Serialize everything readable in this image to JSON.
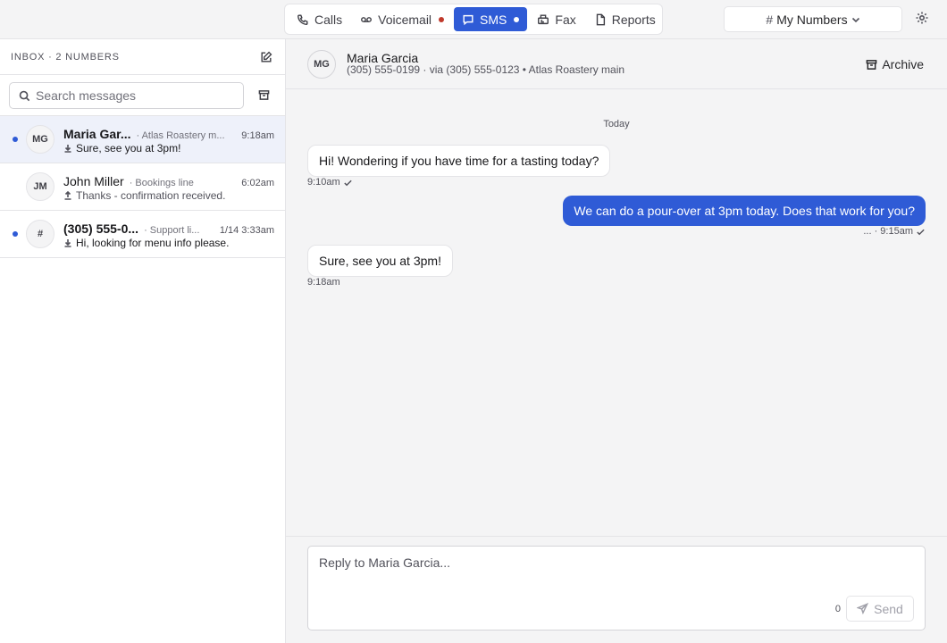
{
  "nav": {
    "tabs": [
      {
        "label": "Calls",
        "icon": "phone-icon",
        "active": false,
        "badge": false
      },
      {
        "label": "Voicemail",
        "icon": "voicemail-icon",
        "active": false,
        "badge": true
      },
      {
        "label": "SMS",
        "icon": "message-icon",
        "active": true,
        "badge": true
      },
      {
        "label": "Fax",
        "icon": "fax-icon",
        "active": false,
        "badge": false
      },
      {
        "label": "Reports",
        "icon": "report-icon",
        "active": false,
        "badge": false
      }
    ],
    "numbers_select": "My Numbers",
    "accent_color": "#2f5bd6",
    "badge_color": "#c0392b"
  },
  "sidebar": {
    "title": "INBOX · 2 NUMBERS",
    "search_placeholder": "Search messages",
    "conversations": [
      {
        "initials": "MG",
        "name": "Maria Gar...",
        "line": "· Atlas Roastery m...",
        "time": "9:18am",
        "direction": "inbound",
        "preview": "Sure, see you at 3pm!",
        "unread": true,
        "selected": true
      },
      {
        "initials": "JM",
        "name": "John Miller",
        "line": "· Bookings line",
        "time": "6:02am",
        "direction": "outbound",
        "preview": "Thanks - confirmation received.",
        "unread": false,
        "selected": false
      },
      {
        "initials": "#",
        "name": "(305) 555-0...",
        "line": "· Support li...",
        "time": "1/14 3:33am",
        "direction": "inbound",
        "preview": "Hi, looking for menu info please.",
        "unread": true,
        "selected": false
      }
    ]
  },
  "conversation": {
    "initials": "MG",
    "name": "Maria Garcia",
    "meta": "(305) 555-0199 · via (305) 555-0123 • Atlas Roastery main",
    "archive_label": "Archive",
    "day_label": "Today",
    "messages": [
      {
        "direction": "in",
        "text": "Hi! Wondering if you have time for a tasting today?",
        "meta": "9:10am",
        "check": true
      },
      {
        "direction": "out",
        "text": "We can do a pour-over at 3pm today. Does that work for you?",
        "meta": "... · 9:15am",
        "check": true
      },
      {
        "direction": "in",
        "text": "Sure, see you at 3pm!",
        "meta": "9:18am",
        "check": false
      }
    ]
  },
  "composer": {
    "placeholder": "Reply to Maria Garcia...",
    "char_count": "0",
    "send_label": "Send"
  }
}
